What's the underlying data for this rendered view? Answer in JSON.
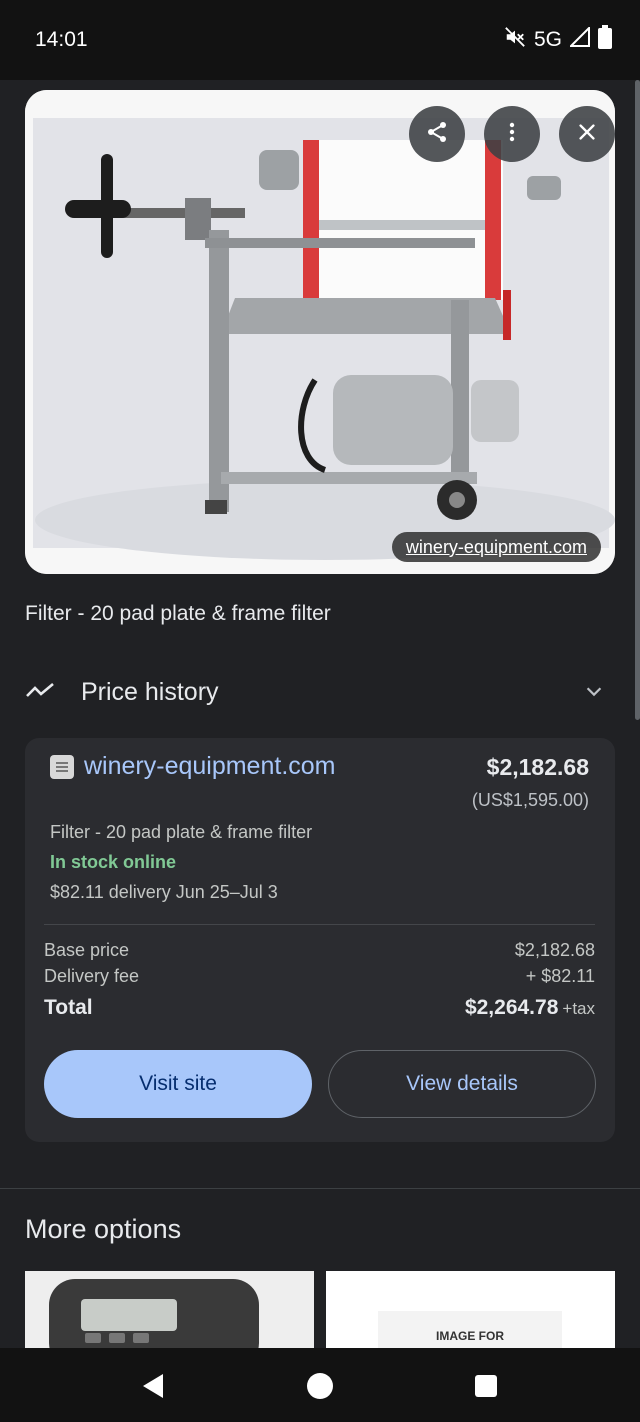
{
  "status": {
    "time": "14:01",
    "network": "5G",
    "icons": [
      "mute-icon",
      "signal-icon",
      "battery-icon"
    ]
  },
  "image_viewer": {
    "source": "winery-equipment.com",
    "buttons": [
      "share-icon",
      "more-vert-icon",
      "close-icon"
    ]
  },
  "product": {
    "title": "Filter - 20 pad plate & frame filter"
  },
  "price_history": {
    "label": "Price history"
  },
  "offer": {
    "store": "winery-equipment.com",
    "price": "$2,182.68",
    "price_usd": "(US$1,595.00)",
    "title": "Filter - 20 pad plate & frame filter",
    "stock": "In stock online",
    "delivery": "$82.11 delivery Jun 25–Jul 3",
    "base_price_label": "Base price",
    "base_price_value": "$2,182.68",
    "delivery_fee_label": "Delivery fee",
    "delivery_fee_value": "+ $82.11",
    "total_label": "Total",
    "total_value": "$2,264.78",
    "total_tax": "+tax",
    "visit_label": "Visit site",
    "details_label": "View details"
  },
  "more_options": {
    "title": "More options",
    "card2_text": "IMAGE FOR"
  },
  "colors": {
    "background": "#202124",
    "card": "#2b2c30",
    "accent": "#a8c7fa",
    "stock_green": "#81c995"
  }
}
